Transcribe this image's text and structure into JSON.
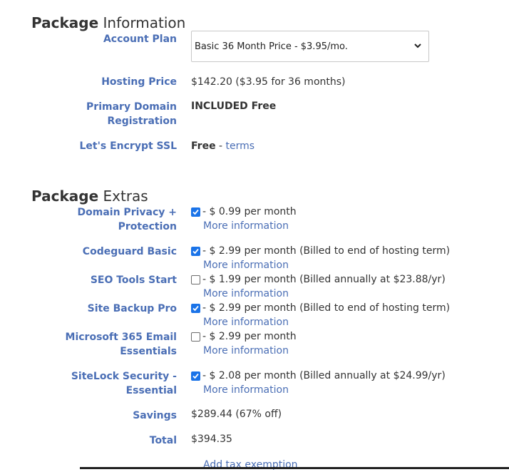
{
  "package_info": {
    "heading_strong": "Package",
    "heading_rest": "Information",
    "account_plan_label": "Account Plan",
    "account_plan_value": "Basic 36 Month Price - $3.95/mo.",
    "hosting_price_label": "Hosting Price",
    "hosting_price_value": "$142.20  ($3.95 for 36 months)",
    "primary_domain_label_1": "Primary Domain",
    "primary_domain_label_2": "Registration",
    "primary_domain_value": "INCLUDED Free",
    "ssl_label": "Let's Encrypt SSL",
    "ssl_value": "Free",
    "ssl_sep": " - ",
    "ssl_terms": "terms"
  },
  "package_extras": {
    "heading_strong": "Package",
    "heading_rest": "Extras",
    "more_info_text": "More information",
    "items": [
      {
        "label_1": "Domain Privacy +",
        "label_2": "Protection",
        "checked": true,
        "price": "- $ 0.99 per month",
        "more": "More information"
      },
      {
        "label_1": "Codeguard Basic",
        "label_2": "",
        "checked": true,
        "price": "- $ 2.99 per month (Billed to end of hosting term)",
        "more": "More information"
      },
      {
        "label_1": "SEO Tools Start",
        "label_2": "",
        "checked": false,
        "price": "- $ 1.99 per month (Billed annually at $23.88/yr)",
        "more": "More information"
      },
      {
        "label_1": "Site Backup Pro",
        "label_2": "",
        "checked": true,
        "price": "- $ 2.99 per month (Billed to end of hosting term)",
        "more": "More information"
      },
      {
        "label_1": "Microsoft 365 Email",
        "label_2": "Essentials",
        "checked": false,
        "price": "- $ 2.99 per month",
        "more": "More information"
      },
      {
        "label_1": "SiteLock Security -",
        "label_2": "Essential",
        "checked": true,
        "price": "- $ 2.08 per month (Billed annually at $24.99/yr)",
        "more": "More information"
      }
    ]
  },
  "totals": {
    "savings_label": "Savings",
    "savings_value": "$289.44 (67% off)",
    "total_label": "Total",
    "total_value": "$394.35",
    "tax_link": "Add tax exemption"
  },
  "colors": {
    "label_blue": "#4a6eb5",
    "checkbox_blue": "#1a73e8",
    "text": "#333333"
  }
}
